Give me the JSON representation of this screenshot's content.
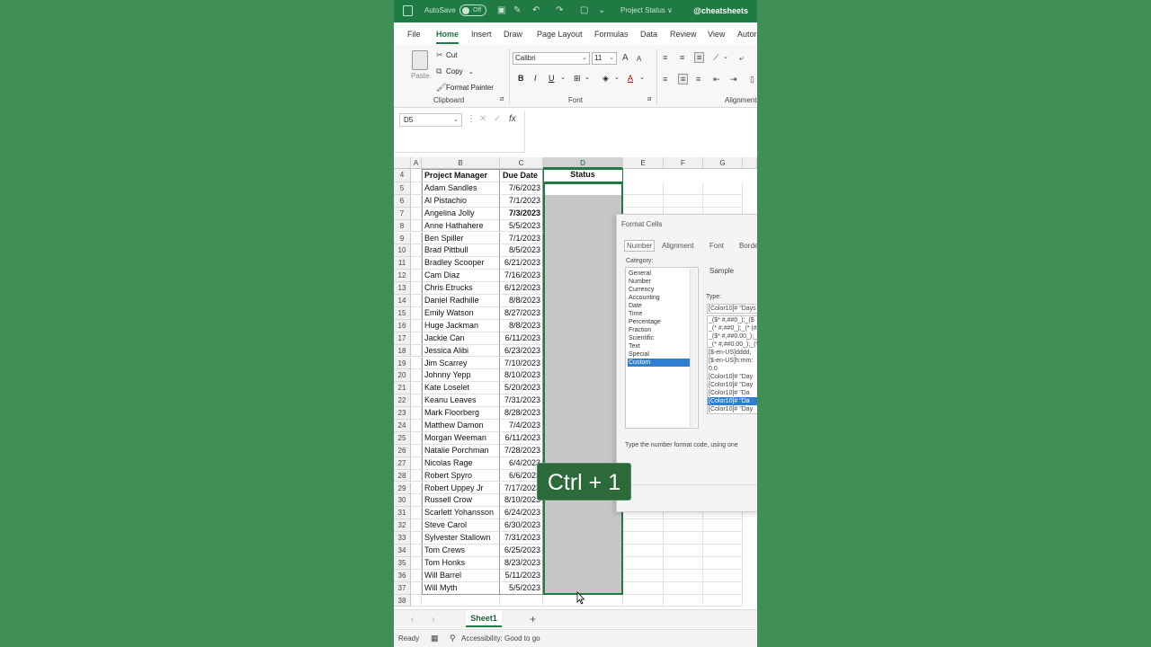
{
  "titlebar": {
    "autosave_label": "AutoSave",
    "toggle_state": "Off",
    "document_name": "Project Status ∨",
    "handle": "@cheatsheets"
  },
  "ribbon_tabs": [
    "File",
    "Home",
    "Insert",
    "Draw",
    "Page Layout",
    "Formulas",
    "Data",
    "Review",
    "View",
    "Autor"
  ],
  "active_tab": "Home",
  "clipboard": {
    "paste_label": "Paste",
    "cut_label": "Cut",
    "copy_label": "Copy",
    "format_painter_label": "Format Painter",
    "group_label": "Clipboard"
  },
  "font": {
    "font_name": "Calibri",
    "font_size": "11",
    "group_label": "Font"
  },
  "alignment": {
    "group_label": "Alignment"
  },
  "formula_bar": {
    "name_box": "D5",
    "fx_label": "fx"
  },
  "columns": [
    "A",
    "B",
    "C",
    "D",
    "E",
    "F",
    "G"
  ],
  "selected_column": "D",
  "header_row": {
    "row_number": "4",
    "project_manager": "Project Manager",
    "due_date": "Due Date",
    "status": "Status"
  },
  "rows": [
    {
      "n": "5",
      "pm": "Adam Sandles",
      "date": "7/6/2023"
    },
    {
      "n": "6",
      "pm": "Al Pistachio",
      "date": "7/1/2023"
    },
    {
      "n": "7",
      "pm": "Angelina Jolly",
      "date": "7/3/2023"
    },
    {
      "n": "8",
      "pm": "Anne Hathahere",
      "date": "5/5/2023"
    },
    {
      "n": "9",
      "pm": "Ben Spiller",
      "date": "7/1/2023"
    },
    {
      "n": "10",
      "pm": "Brad Pittbull",
      "date": "8/5/2023"
    },
    {
      "n": "11",
      "pm": "Bradley Scooper",
      "date": "6/21/2023"
    },
    {
      "n": "12",
      "pm": "Cam Diaz",
      "date": "7/16/2023"
    },
    {
      "n": "13",
      "pm": "Chris Etrucks",
      "date": "6/12/2023"
    },
    {
      "n": "14",
      "pm": "Daniel Radhille",
      "date": "8/8/2023"
    },
    {
      "n": "15",
      "pm": "Emily Watson",
      "date": "8/27/2023"
    },
    {
      "n": "16",
      "pm": "Huge Jackman",
      "date": "8/8/2023"
    },
    {
      "n": "17",
      "pm": "Jackie Can",
      "date": "6/11/2023"
    },
    {
      "n": "18",
      "pm": "Jessica Alibi",
      "date": "6/23/2023"
    },
    {
      "n": "19",
      "pm": "Jim Scarrey",
      "date": "7/10/2023"
    },
    {
      "n": "20",
      "pm": "Johnny Yepp",
      "date": "8/10/2023"
    },
    {
      "n": "21",
      "pm": "Kate Loselet",
      "date": "5/20/2023"
    },
    {
      "n": "22",
      "pm": "Keanu Leaves",
      "date": "7/31/2023"
    },
    {
      "n": "23",
      "pm": "Mark Floorberg",
      "date": "8/28/2023"
    },
    {
      "n": "24",
      "pm": "Matthew Damon",
      "date": "7/4/2023"
    },
    {
      "n": "25",
      "pm": "Morgan Weeman",
      "date": "6/11/2023"
    },
    {
      "n": "26",
      "pm": "Natalie Porchman",
      "date": "7/28/2023"
    },
    {
      "n": "27",
      "pm": "Nicolas Rage",
      "date": "6/4/2023"
    },
    {
      "n": "28",
      "pm": "Robert Spyro",
      "date": "6/6/2023"
    },
    {
      "n": "29",
      "pm": "Robert Uppey Jr",
      "date": "7/17/2023"
    },
    {
      "n": "30",
      "pm": "Russell Crow",
      "date": "8/10/2023"
    },
    {
      "n": "31",
      "pm": "Scarlett Yohansson",
      "date": "6/24/2023"
    },
    {
      "n": "32",
      "pm": "Steve Carol",
      "date": "6/30/2023"
    },
    {
      "n": "33",
      "pm": "Sylvester Stallown",
      "date": "7/31/2023"
    },
    {
      "n": "34",
      "pm": "Tom Crews",
      "date": "6/25/2023"
    },
    {
      "n": "35",
      "pm": "Tom Honks",
      "date": "8/23/2023"
    },
    {
      "n": "36",
      "pm": "Will Barrel",
      "date": "5/11/2023"
    },
    {
      "n": "37",
      "pm": "Will Myth",
      "date": "5/5/2023"
    },
    {
      "n": "38",
      "pm": "",
      "date": ""
    }
  ],
  "dialog": {
    "title": "Format Cells",
    "tabs": [
      "Number",
      "Alignment",
      "Font",
      "Borde"
    ],
    "active_tab": "Number",
    "category_label": "Category:",
    "categories": [
      "General",
      "Number",
      "Currency",
      "Accounting",
      "Date",
      "Time",
      "Percentage",
      "Fraction",
      "Scientific",
      "Text",
      "Special",
      "Custom"
    ],
    "selected_category": "Custom",
    "sample_label": "Sample",
    "type_label": "Type:",
    "type_value": "[Color10]# \"Days",
    "type_options": [
      "_($* #,##0_);_($",
      "_(* #,##0_);_(* (#",
      "_($* #,##0.00_);_(",
      "_(* #,##0.00_);_(*",
      "[$-en-US]dddd,",
      "[$-en-US]h:mm:",
      "0.0",
      "[Color10]# \"Day",
      "[Color10]# \"Day",
      "[Color10]# \"Da",
      "[Color10]# \"Da",
      "[Color10]# \"Day"
    ],
    "selected_type_index": 10,
    "help_text": "Type the number format code, using one"
  },
  "shortcut_overlay": "Ctrl + 1",
  "sheet_tabs": {
    "active": "Sheet1",
    "add_label": "+"
  },
  "statusbar": {
    "ready": "Ready",
    "accessibility": "Accessibility: Good to go"
  },
  "colors": {
    "excel_green": "#1f7a43",
    "background_green": "#3f8f57",
    "selection_blue": "#2f7fd0"
  }
}
